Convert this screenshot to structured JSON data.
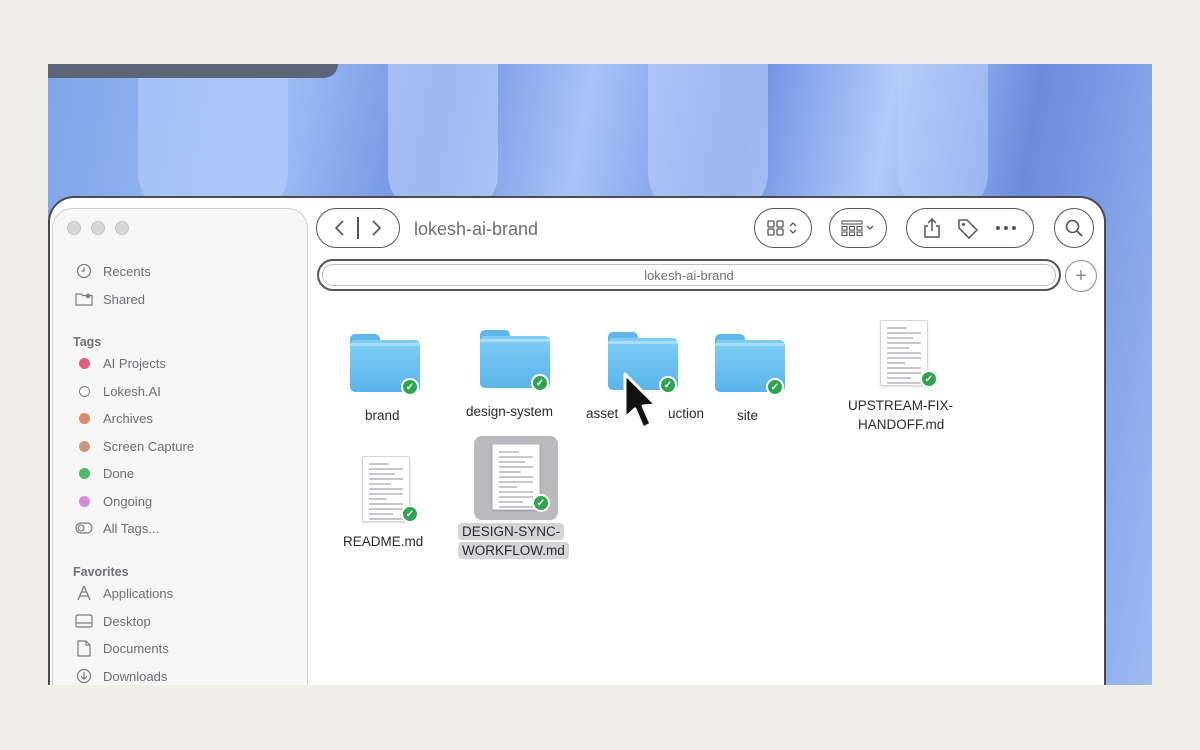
{
  "window": {
    "title": "lokesh-ai-brand",
    "path": "lokesh-ai-brand"
  },
  "sidebar": {
    "top_items": [
      {
        "label": "Recents",
        "icon": "clock-icon"
      },
      {
        "label": "Shared",
        "icon": "shared-folder-icon"
      }
    ],
    "tags_header": "Tags",
    "tags": [
      {
        "label": "AI Projects",
        "color": "#e0607a"
      },
      {
        "label": "Lokesh.AI",
        "color": "#ffffff"
      },
      {
        "label": "Archives",
        "color": "#d98c6a"
      },
      {
        "label": "Screen Capture",
        "color": "#c9987a"
      },
      {
        "label": "Done",
        "color": "#4bb86a"
      },
      {
        "label": "Ongoing",
        "color": "#d78ad8"
      }
    ],
    "all_tags": "All Tags...",
    "favorites_header": "Favorites",
    "favorites": [
      {
        "label": "Applications",
        "icon": "applications-icon"
      },
      {
        "label": "Desktop",
        "icon": "desktop-icon"
      },
      {
        "label": "Documents",
        "icon": "document-icon"
      },
      {
        "label": "Downloads",
        "icon": "download-icon"
      }
    ]
  },
  "files": [
    {
      "name": "brand",
      "kind": "folder"
    },
    {
      "name": "design-system",
      "kind": "folder"
    },
    {
      "name": "asset-production",
      "kind": "folder"
    },
    {
      "name": "site",
      "kind": "folder"
    },
    {
      "name_line1": "UPSTREAM-FIX-",
      "name_line2": "HANDOFF.md",
      "kind": "markdown"
    },
    {
      "name": "README.md",
      "kind": "markdown"
    },
    {
      "name_line1": "DESIGN-SYNC-",
      "name_line2": "WORKFLOW.md",
      "kind": "markdown",
      "selected": true
    }
  ],
  "asset_label_visible": {
    "left": "asset",
    "right": "uction"
  },
  "colors": {
    "folder": "#5ab4ea",
    "sync_badge": "#2fa34d",
    "selection": "#b9b9bd"
  }
}
